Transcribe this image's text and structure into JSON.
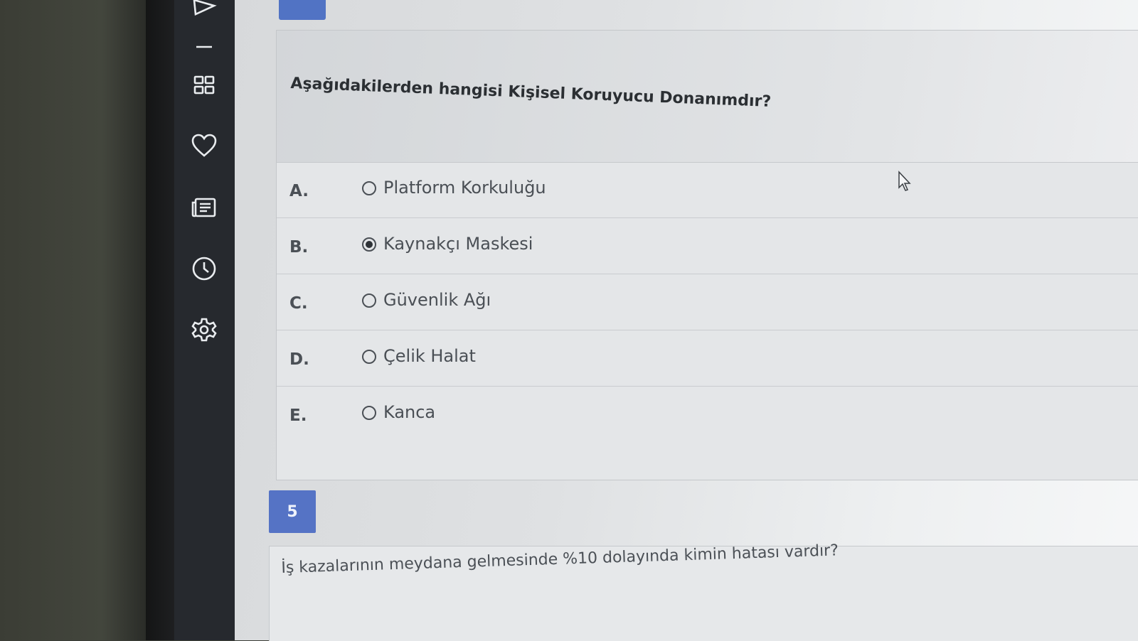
{
  "sidebar": {
    "icons": [
      "play-triangle-icon",
      "grid-icon",
      "heart-icon",
      "document-list-icon",
      "clock-icon",
      "gear-icon"
    ]
  },
  "question": {
    "text": "Aşağıdakilerden hangisi Kişisel Koruyucu Donanımdır?",
    "options": [
      {
        "letter": "A.",
        "label": "Platform Korkuluğu",
        "selected": false
      },
      {
        "letter": "B.",
        "label": "Kaynakçı Maskesi",
        "selected": true
      },
      {
        "letter": "C.",
        "label": "Güvenlik Ağı",
        "selected": false
      },
      {
        "letter": "D.",
        "label": "Çelik Halat",
        "selected": false
      },
      {
        "letter": "E.",
        "label": "Kanca",
        "selected": false
      }
    ]
  },
  "next_question": {
    "number": "5",
    "text": "İş kazalarının meydana gelmesinde %10 dolayında kimin hatası vardır?"
  },
  "colors": {
    "accent": "#5573c5",
    "sidebar": "#26292e"
  }
}
